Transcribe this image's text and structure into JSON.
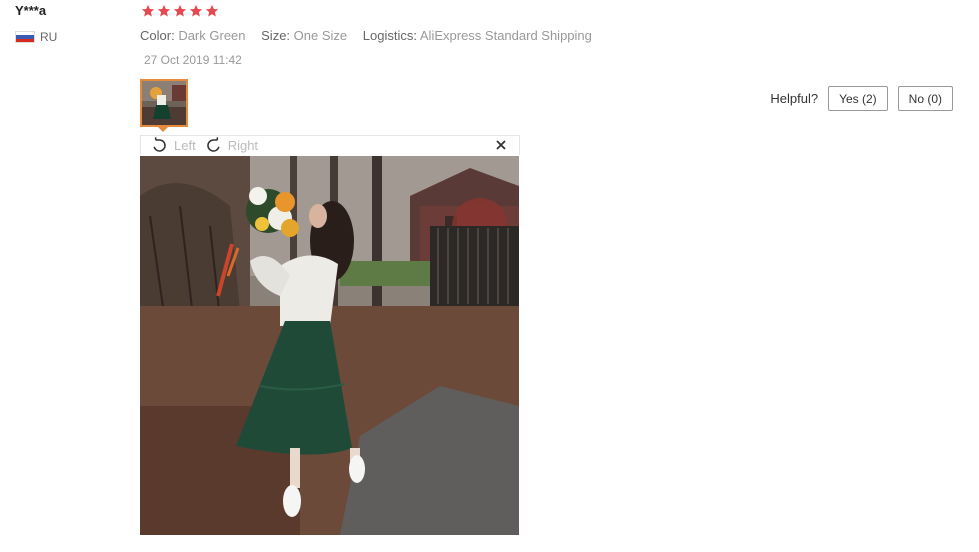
{
  "reviewer": {
    "name": "Y***a",
    "country": "RU"
  },
  "rating": {
    "stars": 5,
    "color": "#e5494d"
  },
  "attributes": [
    {
      "label": "Color:",
      "value": "Dark Green"
    },
    {
      "label": "Size:",
      "value": "One Size"
    },
    {
      "label": "Logistics:",
      "value": "AliExpress Standard Shipping"
    }
  ],
  "date": "27 Oct 2019 11:42",
  "helpful": {
    "label": "Helpful?",
    "yes": "Yes (2)",
    "no": "No (0)"
  },
  "viewer": {
    "rotate_left": "Left",
    "rotate_right": "Right",
    "close": "×",
    "accent": "#e68a3c"
  }
}
